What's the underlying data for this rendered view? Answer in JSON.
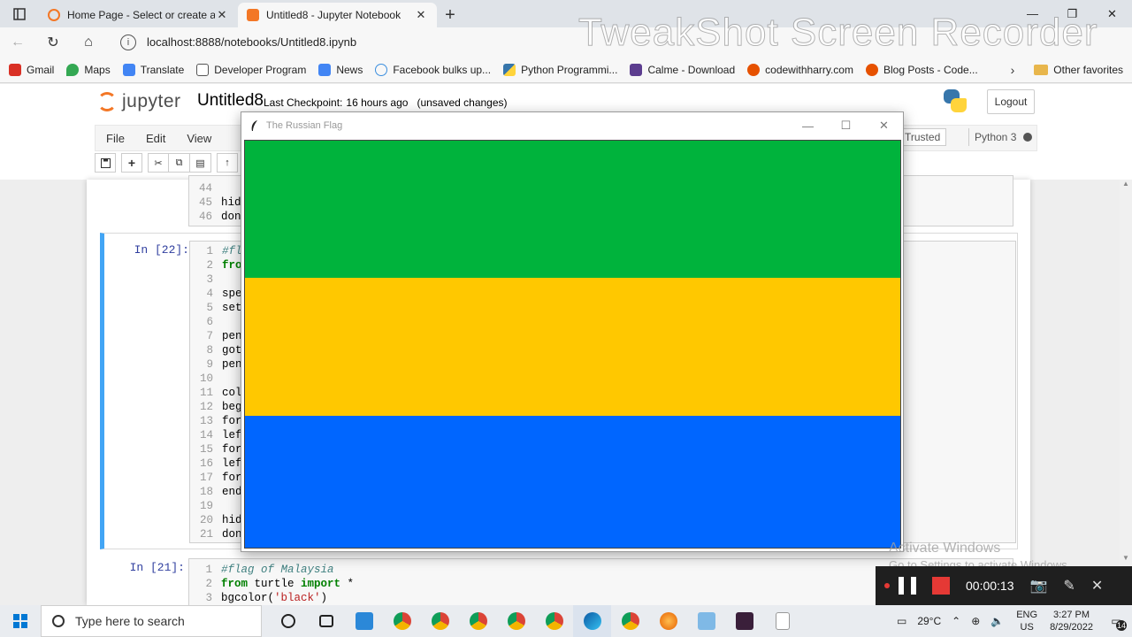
{
  "browser": {
    "tabs": [
      {
        "title": "Home Page - Select or create a n",
        "active": false,
        "favicon_color": "#f37726"
      },
      {
        "title": "Untitled8 - Jupyter Notebook",
        "active": true,
        "favicon_color": "#f37726"
      }
    ],
    "url": "localhost:8888/notebooks/Untitled8.ipynb",
    "bookmarks": [
      {
        "label": "Gmail",
        "icon_color": "#d93025"
      },
      {
        "label": "Maps",
        "icon_color": "#34a853"
      },
      {
        "label": "Translate",
        "icon_color": "#4285f4"
      },
      {
        "label": "Developer Program",
        "icon_color": "#555555"
      },
      {
        "label": "News",
        "icon_color": "#4285f4"
      },
      {
        "label": "Facebook bulks up...",
        "icon_color": "#3b8ede"
      },
      {
        "label": "Python Programmi...",
        "icon_color": "#3776ab"
      },
      {
        "label": "Calme - Download",
        "icon_color": "#5c3d8f"
      },
      {
        "label": "codewithharry.com",
        "icon_color": "#e65100"
      },
      {
        "label": "Blog Posts - Code...",
        "icon_color": "#e65100"
      }
    ],
    "other_favorites": "Other favorites"
  },
  "jupyter": {
    "logo_text": "jupyter",
    "notebook_name": "Untitled8",
    "checkpoint_label": "Last Checkpoint:",
    "checkpoint_time": "16 hours ago",
    "unsaved": "(unsaved changes)",
    "logout": "Logout",
    "menu": [
      "File",
      "Edit",
      "View"
    ],
    "trusted": "Trusted",
    "kernel": "Python 3"
  },
  "cells": {
    "top": {
      "lines": [
        {
          "n": "44",
          "code": ""
        },
        {
          "n": "45",
          "code": "hid"
        },
        {
          "n": "46",
          "code": "don"
        }
      ]
    },
    "middle": {
      "prompt": "In [22]:",
      "lines": [
        {
          "n": "1",
          "code": "#fl",
          "kind": "cmt"
        },
        {
          "n": "2",
          "code": "fro",
          "kind": "kw"
        },
        {
          "n": "3",
          "code": ""
        },
        {
          "n": "4",
          "code": "spe"
        },
        {
          "n": "5",
          "code": "set"
        },
        {
          "n": "6",
          "code": ""
        },
        {
          "n": "7",
          "code": "pen"
        },
        {
          "n": "8",
          "code": "got"
        },
        {
          "n": "9",
          "code": "pen"
        },
        {
          "n": "10",
          "code": ""
        },
        {
          "n": "11",
          "code": "col"
        },
        {
          "n": "12",
          "code": "beg"
        },
        {
          "n": "13",
          "code": "for"
        },
        {
          "n": "14",
          "code": "lef"
        },
        {
          "n": "15",
          "code": "for"
        },
        {
          "n": "16",
          "code": "lef"
        },
        {
          "n": "17",
          "code": "for"
        },
        {
          "n": "18",
          "code": "end"
        },
        {
          "n": "19",
          "code": ""
        },
        {
          "n": "20",
          "code": "hid"
        },
        {
          "n": "21",
          "code": "don"
        }
      ]
    },
    "bottom": {
      "prompt": "In [21]:",
      "line1": {
        "n": "1",
        "code": "#flag of Malaysia"
      },
      "line2": {
        "n": "2",
        "kw1": "from",
        "mid": " turtle ",
        "kw2": "import",
        "rest": " *"
      },
      "line3": {
        "n": "3",
        "fn": "bgcolor(",
        "str": "'black'",
        "end": ")"
      }
    }
  },
  "turtle_window": {
    "title": "The Russian Flag",
    "bands": [
      {
        "color": "#00b33c",
        "name": "green"
      },
      {
        "color": "#ffc800",
        "name": "yellow"
      },
      {
        "color": "#0066ff",
        "name": "blue"
      }
    ]
  },
  "watermark": "TweakShot Screen Recorder",
  "activate_windows": {
    "title": "Activate Windows",
    "subtitle": "Go to Settings to activate Windows."
  },
  "recorder": {
    "time": "00:00:13"
  },
  "taskbar": {
    "search_placeholder": "Type here to search",
    "weather": "29°C",
    "lang1": "ENG",
    "lang2": "US",
    "time": "3:27 PM",
    "date": "8/29/2022",
    "notifications": "14"
  }
}
